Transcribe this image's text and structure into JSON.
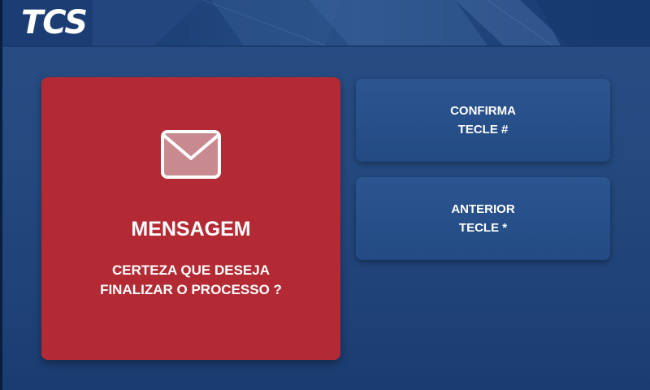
{
  "header": {
    "logo_text": "TCS"
  },
  "message": {
    "icon": "envelope-icon",
    "title": "MENSAGEM",
    "lines": [
      "CERTEZA QUE DESEJA",
      "FINALIZAR O PROCESSO ?"
    ]
  },
  "options": {
    "confirm": {
      "line1": "CONFIRMA",
      "line2": "TECLE #"
    },
    "back": {
      "line1": "ANTERIOR",
      "line2": "TECLE *"
    }
  },
  "colors": {
    "background": "#244a80",
    "message_card": "#b32a34",
    "button": "#2a5189",
    "text": "#ffffff"
  }
}
